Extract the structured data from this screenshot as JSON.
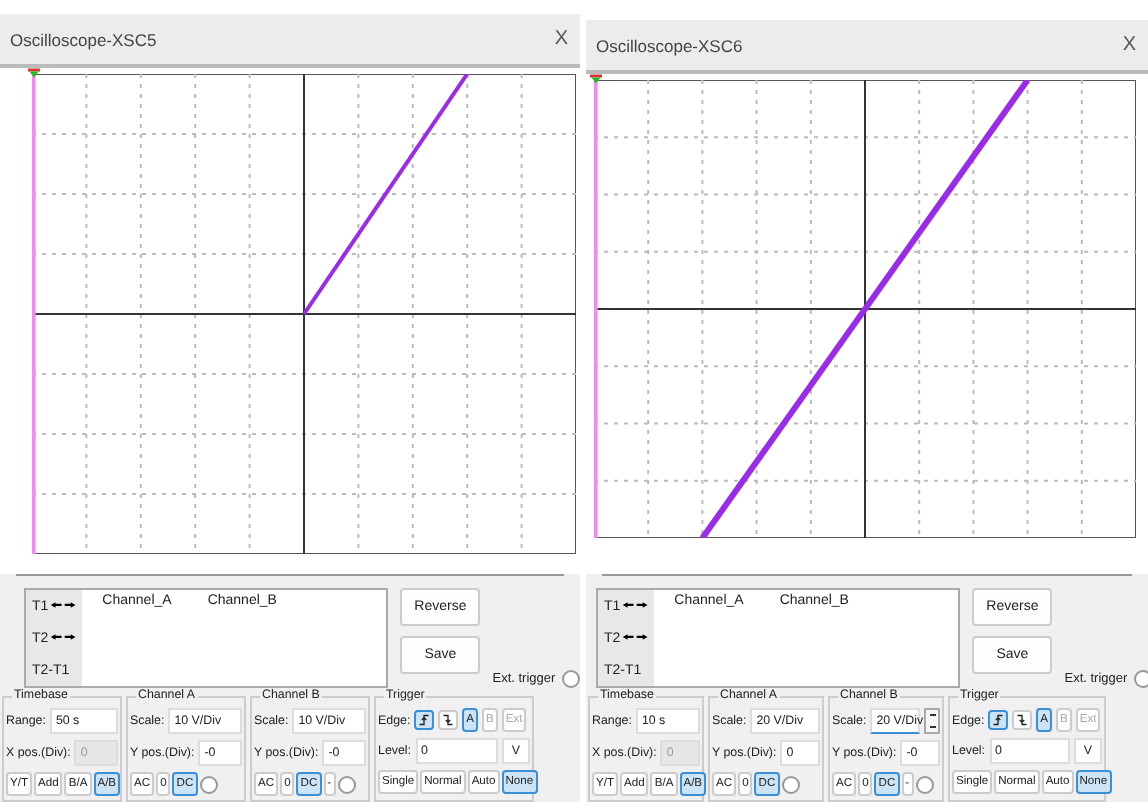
{
  "windows": [
    {
      "title": "Oscilloscope-XSC5",
      "close": "X",
      "trace": {
        "kind": "half"
      },
      "cursors": [
        "T1",
        "T2",
        "T2-T1"
      ],
      "arrows": [
        "🠘",
        "🠚"
      ],
      "channels": [
        "Channel_A",
        "Channel_B"
      ],
      "buttons": [
        "Reverse",
        "Save"
      ],
      "ext_trigger": {
        "label": "Ext. trigger",
        "checked": false
      },
      "timebase": {
        "title": "Timebase",
        "range_label": "Range:",
        "range": "50  s",
        "xpos_label": "X pos.(Div):",
        "xpos": "0",
        "modes": [
          {
            "label": "Y/T",
            "selected": false
          },
          {
            "label": "Add",
            "selected": false
          },
          {
            "label": "B/A",
            "selected": false
          },
          {
            "label": "A/B",
            "selected": true
          }
        ]
      },
      "channel_a": {
        "title": "Channel A",
        "scale_label": "Scale:",
        "scale": "10  V/Div",
        "scale_focused": false,
        "ypos_label": "Y pos.(Div):",
        "ypos": "-0",
        "couplings": [
          {
            "label": "AC",
            "selected": false
          },
          {
            "label": "0",
            "selected": false
          },
          {
            "label": "DC",
            "selected": true
          }
        ],
        "radio_checked": false
      },
      "channel_b": {
        "title": "Channel B",
        "scale_label": "Scale:",
        "scale": "10  V/Div",
        "scale_focused": false,
        "ypos_label": "Y pos.(Div):",
        "ypos": "-0",
        "couplings": [
          {
            "label": "AC",
            "selected": false
          },
          {
            "label": "0",
            "selected": false
          },
          {
            "label": "DC",
            "selected": true
          },
          {
            "label": "-",
            "selected": false
          }
        ],
        "radio_checked": false
      },
      "trigger": {
        "title": "Trigger",
        "edge_label": "Edge:",
        "edges": [
          {
            "kind": "rising",
            "selected": true
          },
          {
            "kind": "falling",
            "selected": false
          }
        ],
        "sources": [
          {
            "label": "A",
            "selected": true,
            "disabled": false
          },
          {
            "label": "B",
            "selected": false,
            "disabled": true
          },
          {
            "label": "Ext",
            "selected": false,
            "disabled": true
          }
        ],
        "level_label": "Level:",
        "level": "0",
        "unit": "V",
        "modes": [
          {
            "label": "Single",
            "selected": false
          },
          {
            "label": "Normal",
            "selected": false
          },
          {
            "label": "Auto",
            "selected": false
          },
          {
            "label": "None",
            "selected": true
          }
        ]
      }
    },
    {
      "title": "Oscilloscope-XSC6",
      "close": "X",
      "trace": {
        "kind": "full"
      },
      "cursors": [
        "T1",
        "T2",
        "T2-T1"
      ],
      "arrows": [
        "🠘",
        "🠚"
      ],
      "channels": [
        "Channel_A",
        "Channel_B"
      ],
      "buttons": [
        "Reverse",
        "Save"
      ],
      "ext_trigger": {
        "label": "Ext. trigger",
        "checked": false
      },
      "timebase": {
        "title": "Timebase",
        "range_label": "Range:",
        "range": "10  s",
        "xpos_label": "X pos.(Div):",
        "xpos": "0",
        "modes": [
          {
            "label": "Y/T",
            "selected": false
          },
          {
            "label": "Add",
            "selected": false
          },
          {
            "label": "B/A",
            "selected": false
          },
          {
            "label": "A/B",
            "selected": true
          }
        ]
      },
      "channel_a": {
        "title": "Channel A",
        "scale_label": "Scale:",
        "scale": "20  V/Div",
        "scale_focused": false,
        "ypos_label": "Y pos.(Div):",
        "ypos": "0",
        "couplings": [
          {
            "label": "AC",
            "selected": false
          },
          {
            "label": "0",
            "selected": false
          },
          {
            "label": "DC",
            "selected": true
          }
        ],
        "radio_checked": false
      },
      "channel_b": {
        "title": "Channel B",
        "scale_label": "Scale:",
        "scale": "20  V/Div",
        "scale_focused": true,
        "ypos_label": "Y pos.(Div):",
        "ypos": "-0",
        "couplings": [
          {
            "label": "AC",
            "selected": false
          },
          {
            "label": "0",
            "selected": false
          },
          {
            "label": "DC",
            "selected": true
          },
          {
            "label": "-",
            "selected": false
          }
        ],
        "radio_checked": false
      },
      "trigger": {
        "title": "Trigger",
        "edge_label": "Edge:",
        "edges": [
          {
            "kind": "rising",
            "selected": true
          },
          {
            "kind": "falling",
            "selected": false
          }
        ],
        "sources": [
          {
            "label": "A",
            "selected": true,
            "disabled": false
          },
          {
            "label": "B",
            "selected": false,
            "disabled": true
          },
          {
            "label": "Ext",
            "selected": false,
            "disabled": true
          }
        ],
        "level_label": "Level:",
        "level": "0",
        "unit": "V",
        "modes": [
          {
            "label": "Single",
            "selected": false
          },
          {
            "label": "Normal",
            "selected": false
          },
          {
            "label": "Auto",
            "selected": false
          },
          {
            "label": "None",
            "selected": true
          }
        ]
      }
    }
  ]
}
